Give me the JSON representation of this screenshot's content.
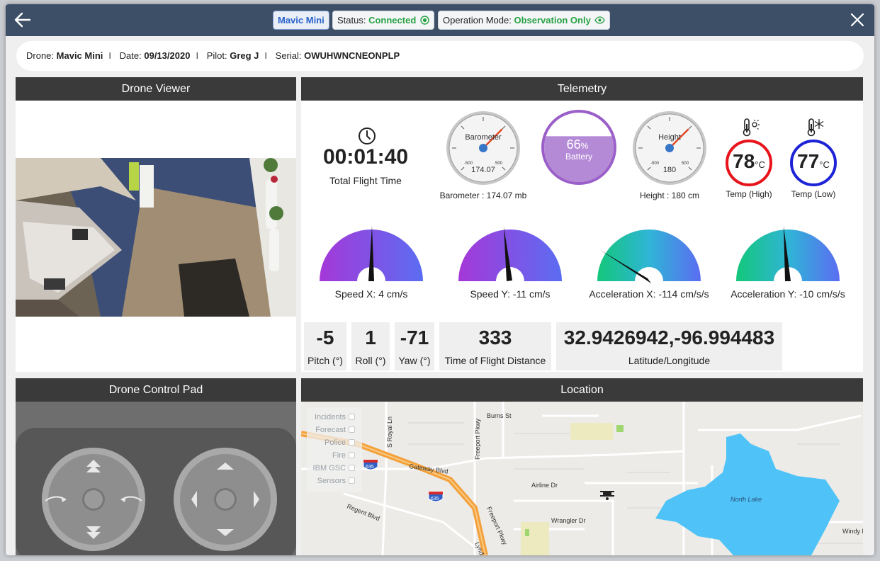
{
  "header": {
    "drone_badge": "Mavic Mini",
    "status_label": "Status:",
    "status_value": "Connected",
    "mode_label": "Operation Mode:",
    "mode_value": "Observation Only"
  },
  "info": {
    "drone_label": "Drone:",
    "drone_value": "Mavic Mini",
    "date_label": "Date:",
    "date_value": "09/13/2020",
    "pilot_label": "Pilot:",
    "pilot_value": "Greg J",
    "serial_label": "Serial:",
    "serial_value": "OWUHWNCNEONPLP"
  },
  "panels": {
    "viewer": "Drone Viewer",
    "telemetry": "Telemetry",
    "control": "Drone Control Pad",
    "location": "Location"
  },
  "telemetry": {
    "flight_time": "00:01:40",
    "flight_time_label": "Total Flight Time",
    "barometer": {
      "dial_label": "Barometer",
      "dial_value": "174.07",
      "min": "-500",
      "max": "500",
      "caption": "Barometer : 174.07 mb"
    },
    "battery": {
      "percent": "66",
      "unit": "%",
      "label": "Battery",
      "level": 0.66
    },
    "height": {
      "dial_label": "Height",
      "dial_value": "180",
      "min": "-500",
      "max": "500",
      "caption": "Height : 180 cm"
    },
    "temp_high": {
      "value": "78",
      "unit": "°C",
      "label": "Temp (High)"
    },
    "temp_low": {
      "value": "77",
      "unit": "°C",
      "label": "Temp (Low)"
    },
    "speed_x": "Speed X: 4 cm/s",
    "speed_y": "Speed Y: -11 cm/s",
    "accel_x": "Acceleration X: -114 cm/s/s",
    "accel_y": "Acceleration Y: -10 cm/s/s",
    "pitch": {
      "value": "-5",
      "label": "Pitch (°)"
    },
    "roll": {
      "value": "1",
      "label": "Roll (°)"
    },
    "yaw": {
      "value": "-71",
      "label": "Yaw (°)"
    },
    "distance": {
      "value": "333",
      "label": "Time of Flight Distance"
    },
    "latlng": {
      "value": "32.9426942,-96.994483",
      "label": "Latitude/Longitude"
    }
  },
  "map": {
    "layers": [
      "Incidents",
      "Forecast",
      "Police",
      "Fire",
      "IBM GSC",
      "Sensors"
    ],
    "labels": {
      "burns": "Burns St",
      "royal": "S Royal Ln",
      "freeport1": "Freeport Pkwy",
      "gateway": "Gateway Blvd",
      "shield1": "635",
      "shield2": "635",
      "airline": "Airline Dr",
      "regent": "Regent Blvd",
      "freeport2": "Freeport Pkwy",
      "wrangler": "Wrangler Dr",
      "lake": "North Lake",
      "windy": "Windy H",
      "lynd": "Lynd"
    }
  },
  "colors": {
    "accent": "#2a62c9",
    "connected": "#27a244",
    "hot": "#e8141c",
    "cold": "#1d23d6",
    "battery": "#9a5fc8",
    "lake": "#4fc3f7"
  }
}
